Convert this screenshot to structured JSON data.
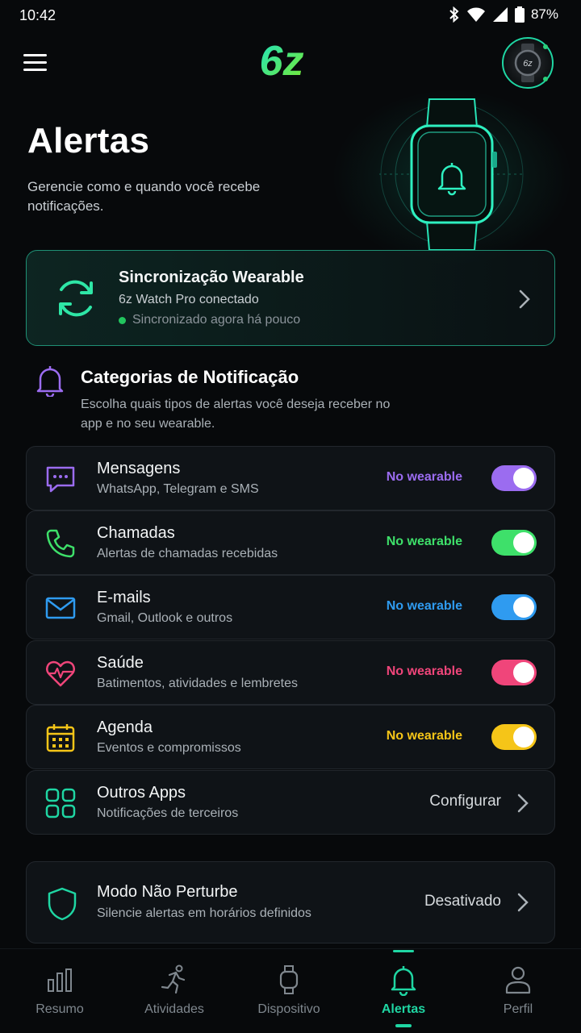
{
  "status_bar": {
    "time": "10:42",
    "battery": "87%"
  },
  "header": {
    "logo_text": "6z",
    "avatar_label": "6z"
  },
  "page": {
    "title": "Alertas",
    "subtitle": "Gerencie como e quando você recebe notificações."
  },
  "sync_card": {
    "title": "Sincronização Wearable",
    "device": "6z Watch Pro conectado",
    "status": "Sincronizado agora há pouco"
  },
  "categories": {
    "title": "Categorias de Notificação",
    "description": "Escolha quais tipos de alertas você deseja receber no app e no seu wearable.",
    "items": [
      {
        "title": "Mensagens",
        "subtitle": "WhatsApp, Telegram e SMS",
        "tag": "No wearable",
        "enabled": true,
        "icon": "message-icon",
        "color": "#9b6cf0"
      },
      {
        "title": "Chamadas",
        "subtitle": "Alertas de chamadas recebidas",
        "tag": "No wearable",
        "enabled": true,
        "icon": "phone-icon",
        "color": "#3ee06a"
      },
      {
        "title": "E-mails",
        "subtitle": "Gmail, Outlook e outros",
        "tag": "No wearable",
        "enabled": true,
        "icon": "mail-icon",
        "color": "#2f9bf0"
      },
      {
        "title": "Saúde",
        "subtitle": "Batimentos, atividades e lembretes",
        "tag": "No wearable",
        "enabled": true,
        "icon": "heart-icon",
        "color": "#f0457a"
      },
      {
        "title": "Agenda",
        "subtitle": "Eventos e compromissos",
        "tag": "No wearable",
        "enabled": true,
        "icon": "calendar-icon",
        "color": "#f5c518"
      },
      {
        "title": "Outros Apps",
        "subtitle": "Notificações de terceiros",
        "action": "Configurar",
        "icon": "apps-grid-icon",
        "color": "#1fd6a3"
      }
    ]
  },
  "dnd": {
    "title": "Modo Não Perturbe",
    "subtitle": "Silencie alertas em horários definidos",
    "value": "Desativado",
    "icon": "shield-icon"
  },
  "nav": {
    "items": [
      {
        "label": "Resumo",
        "icon": "bar-chart-icon"
      },
      {
        "label": "Atividades",
        "icon": "running-icon"
      },
      {
        "label": "Dispositivo",
        "icon": "watch-icon"
      },
      {
        "label": "Alertas",
        "icon": "bell-icon",
        "active": true
      },
      {
        "label": "Perfil",
        "icon": "user-icon"
      }
    ]
  },
  "colors": {
    "accent": "#1fd6a3",
    "background": "#07090b",
    "card": "#0f1317"
  }
}
